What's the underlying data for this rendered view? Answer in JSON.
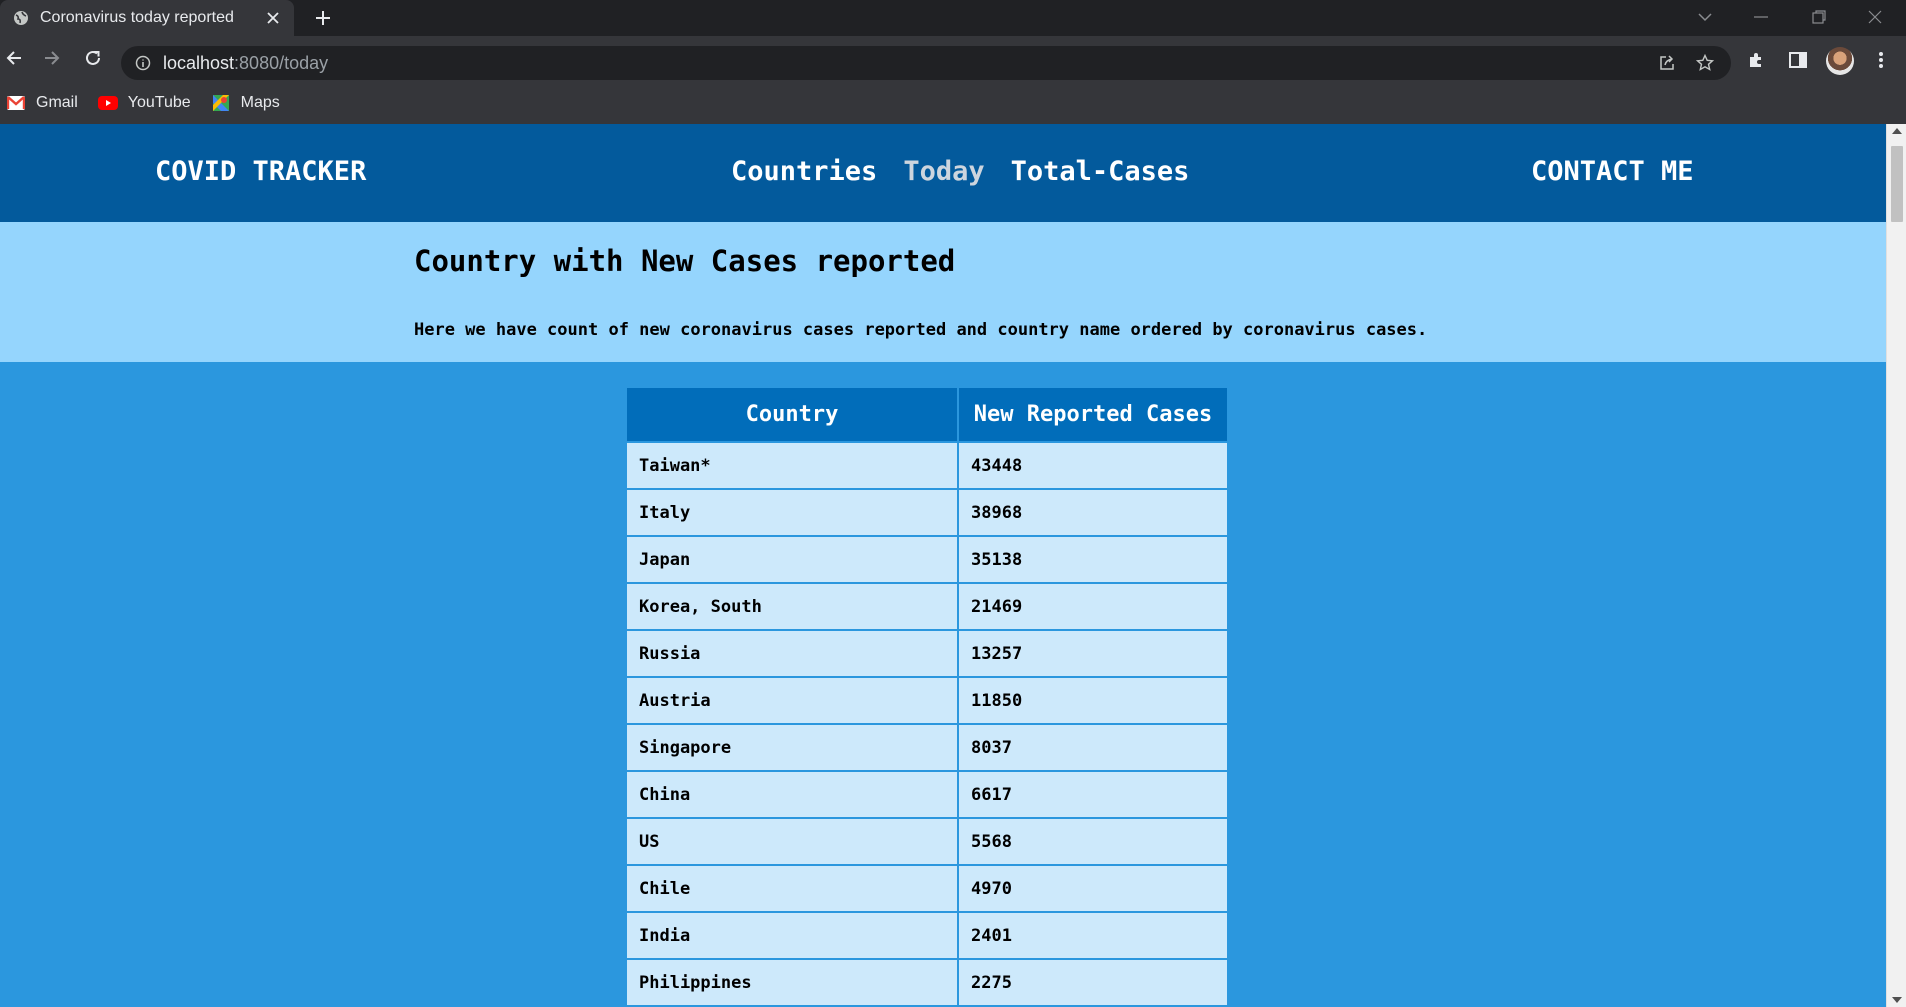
{
  "browser": {
    "tab_title": "Coronavirus today reported",
    "url_host": "localhost",
    "url_rest": ":8080/today",
    "bookmarks": [
      {
        "label": "Gmail",
        "icon": "gmail-icon"
      },
      {
        "label": "YouTube",
        "icon": "youtube-icon"
      },
      {
        "label": "Maps",
        "icon": "maps-icon"
      }
    ]
  },
  "navbar": {
    "brand": "COVID TRACKER",
    "links": [
      "Countries",
      "Today",
      "Total-Cases"
    ],
    "active_link": "Today",
    "contact": "CONTACT ME"
  },
  "intro": {
    "title": "Country with New Cases reported",
    "text": "Here we have count of new coronavirus cases reported and country name ordered by coronavirus cases."
  },
  "table": {
    "headers": [
      "Country",
      "New Reported Cases"
    ],
    "rows": [
      [
        "Taiwan*",
        "43448"
      ],
      [
        "Italy",
        "38968"
      ],
      [
        "Japan",
        "35138"
      ],
      [
        "Korea, South",
        "21469"
      ],
      [
        "Russia",
        "13257"
      ],
      [
        "Austria",
        "11850"
      ],
      [
        "Singapore",
        "8037"
      ],
      [
        "China",
        "6617"
      ],
      [
        "US",
        "5568"
      ],
      [
        "Chile",
        "4970"
      ],
      [
        "India",
        "2401"
      ],
      [
        "Philippines",
        "2275"
      ]
    ]
  },
  "colors": {
    "navbar_bg": "#035a9c",
    "intro_bg": "#95d5fd",
    "page_bg": "#2b97de",
    "table_header_bg": "#016dba",
    "table_cell_bg": "#cde9fb"
  }
}
